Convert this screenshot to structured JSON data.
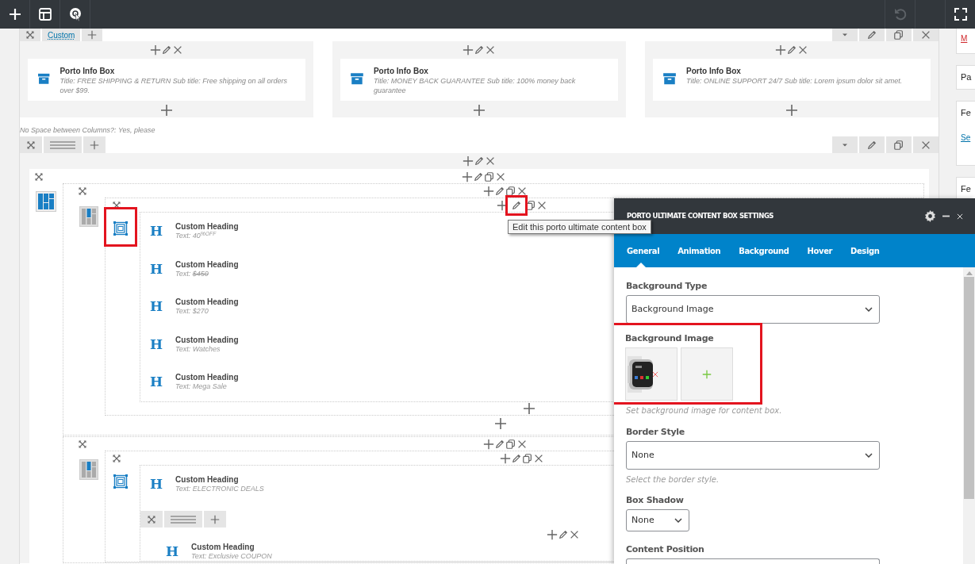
{
  "top_bar": {
    "left": [
      {
        "kind": "add"
      },
      {
        "kind": "templates"
      },
      {
        "kind": "target"
      }
    ],
    "right": [
      {
        "kind": "undo",
        "disabled": true
      },
      {
        "kind": "blank"
      },
      {
        "kind": "fullscreen"
      }
    ]
  },
  "sidebar_cards": [
    {
      "lines": [
        {
          "kind": "alert-link",
          "text": "M"
        }
      ]
    },
    {
      "lines": [
        {
          "kind": "heading",
          "text": "Pa"
        }
      ]
    },
    {
      "lines": [
        {
          "kind": "heading",
          "text": "Fe"
        },
        {
          "kind": "link",
          "text": "Se"
        }
      ]
    },
    {
      "lines": [
        {
          "kind": "heading",
          "text": "Fe"
        }
      ]
    }
  ],
  "row_1": {
    "layout_label": "Custom",
    "columns": [
      {
        "title": "Porto Info Box",
        "description": "Title: FREE SHIPPING & RETURN  Sub title: Free shipping on all orders over $99."
      },
      {
        "title": "Porto Info Box",
        "description": "Title: MONEY BACK GUARANTEE  Sub title: 100% money back guarantee"
      },
      {
        "title": "Porto Info Box",
        "description": "Title: ONLINE SUPPORT 24/7  Sub title: Lorem ipsum dolor sit amet."
      }
    ]
  },
  "row_note": "No Space between Columns?: Yes, please",
  "row_2": {
    "inner_rows": [
      {
        "box_highlighted": true,
        "edit_highlighted": true,
        "tooltip": "Edit this porto ultimate content box",
        "headings": [
          {
            "icon": "H",
            "title": "Custom Heading",
            "prefix": "Text:",
            "value": "40$^{%OFF}$",
            "struck": false
          },
          {
            "icon": "H",
            "title": "Custom Heading",
            "prefix": "Text:",
            "value": "$450",
            "struck": true
          },
          {
            "icon": "H",
            "title": "Custom Heading",
            "prefix": "Text:",
            "value": "$270",
            "struck": false
          },
          {
            "icon": "H",
            "title": "Custom Heading",
            "prefix": "Text:",
            "value": "Watches",
            "struck": false
          },
          {
            "icon": "H",
            "title": "Custom Heading",
            "prefix": "Text:",
            "value": "Mega Sale",
            "struck": false
          }
        ]
      },
      {
        "box_highlighted": false,
        "edit_highlighted": false,
        "headings": [
          {
            "icon": "H",
            "title": "Custom Heading",
            "prefix": "Text:",
            "value": "ELECTRONIC DEALS",
            "struck": false
          }
        ],
        "nested_headings": [
          {
            "icon": "H",
            "title": "Custom Heading",
            "prefix": "Text:",
            "value": "Exclusive COUPON",
            "struck": false
          }
        ]
      }
    ]
  },
  "settings_panel": {
    "title": "PORTO ULTIMATE CONTENT BOX SETTINGS",
    "tabs": [
      {
        "label": "General",
        "selected": true
      },
      {
        "label": "Animation",
        "selected": false
      },
      {
        "label": "Background",
        "selected": false
      },
      {
        "label": "Hover",
        "selected": false
      },
      {
        "label": "Design",
        "selected": false
      }
    ],
    "fields": [
      {
        "kind": "select",
        "label": "Background Type",
        "value": "Background Image"
      },
      {
        "label": "Background Image",
        "highlighted": true,
        "help": "Set background image for content box."
      },
      {
        "kind": "select",
        "label": "Border Style",
        "value": "None",
        "help": "Select the border style."
      },
      {
        "kind": "select-small",
        "label": "Box Shadow",
        "value": "None"
      },
      {
        "kind": "select",
        "label": "Content Position"
      }
    ]
  }
}
